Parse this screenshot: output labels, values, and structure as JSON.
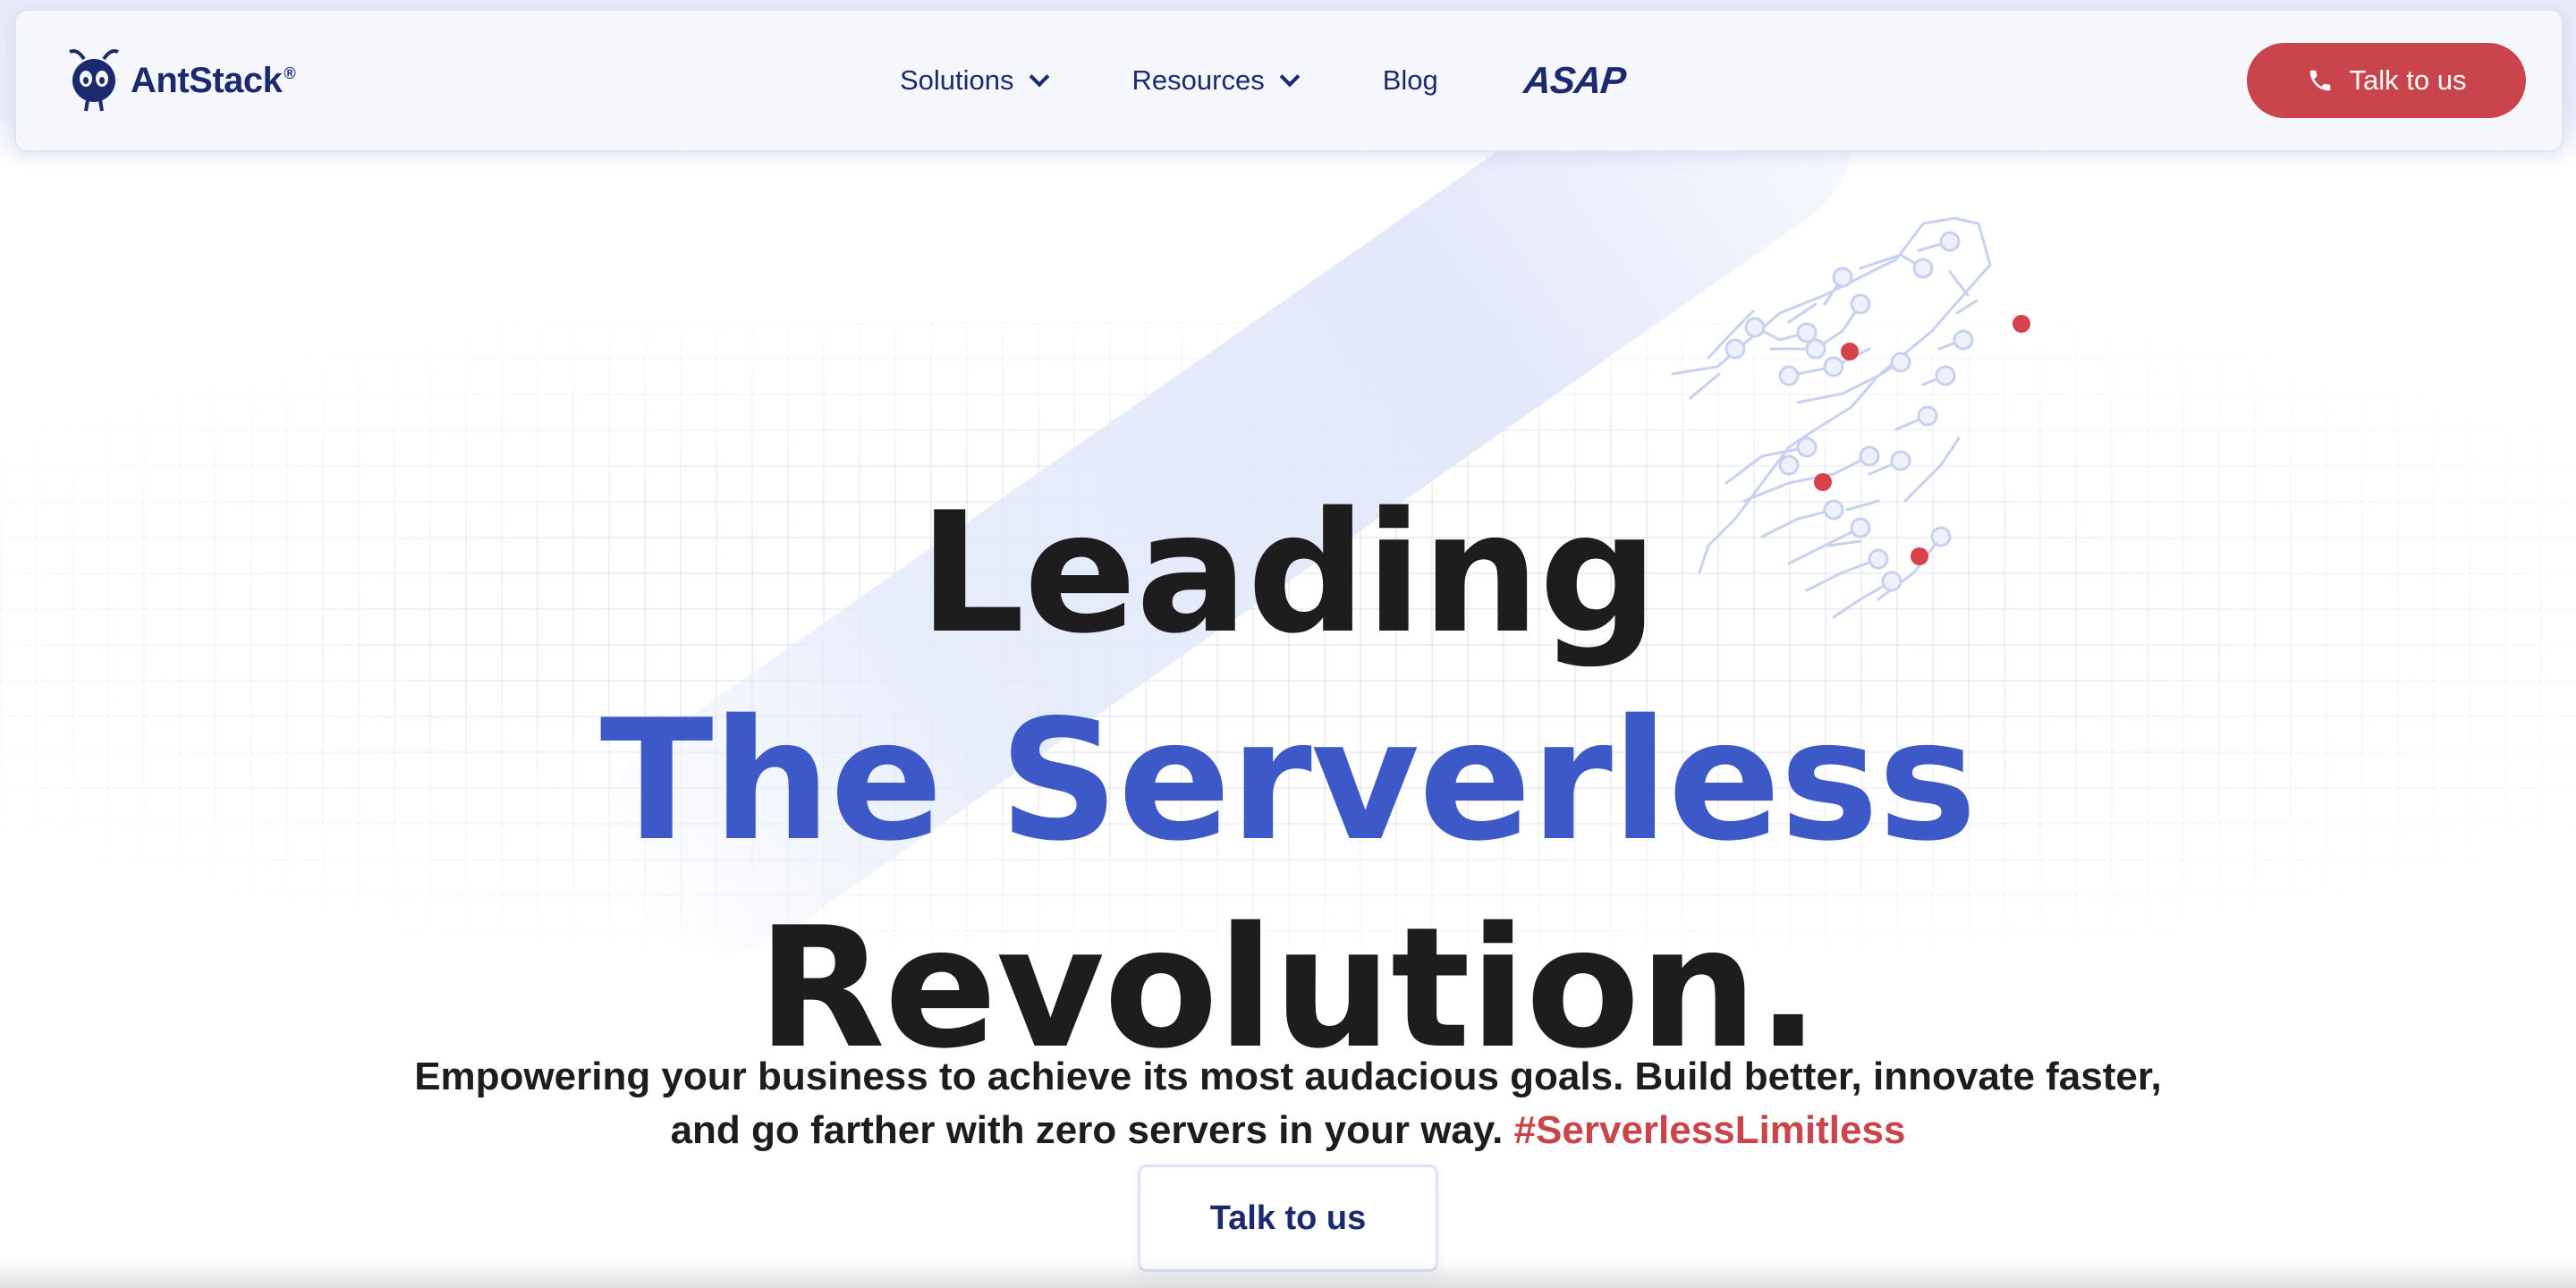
{
  "brand": {
    "name": "AntStack",
    "registered": "®",
    "logo_icon": "ant-icon"
  },
  "nav": {
    "items": [
      {
        "label": "Solutions",
        "has_dropdown": true
      },
      {
        "label": "Resources",
        "has_dropdown": true
      },
      {
        "label": "Blog",
        "has_dropdown": false
      }
    ],
    "asap_logo": "ASAP",
    "cta_label": "Talk to us",
    "cta_icon": "phone-icon"
  },
  "hero": {
    "line1": "Leading",
    "line2": "The Serverless",
    "line3": "Revolution.",
    "subtitle": "Empowering your business to achieve its most audacious goals. Build better, innovate faster, and go farther with zero servers in your way.",
    "hashtag": "#ServerlessLimitless",
    "cta_label": "Talk to us"
  },
  "colors": {
    "brand_navy": "#1b2a6e",
    "accent_blue": "#3c59c7",
    "accent_red": "#c9444b",
    "text_dark": "#1d1d1d"
  }
}
